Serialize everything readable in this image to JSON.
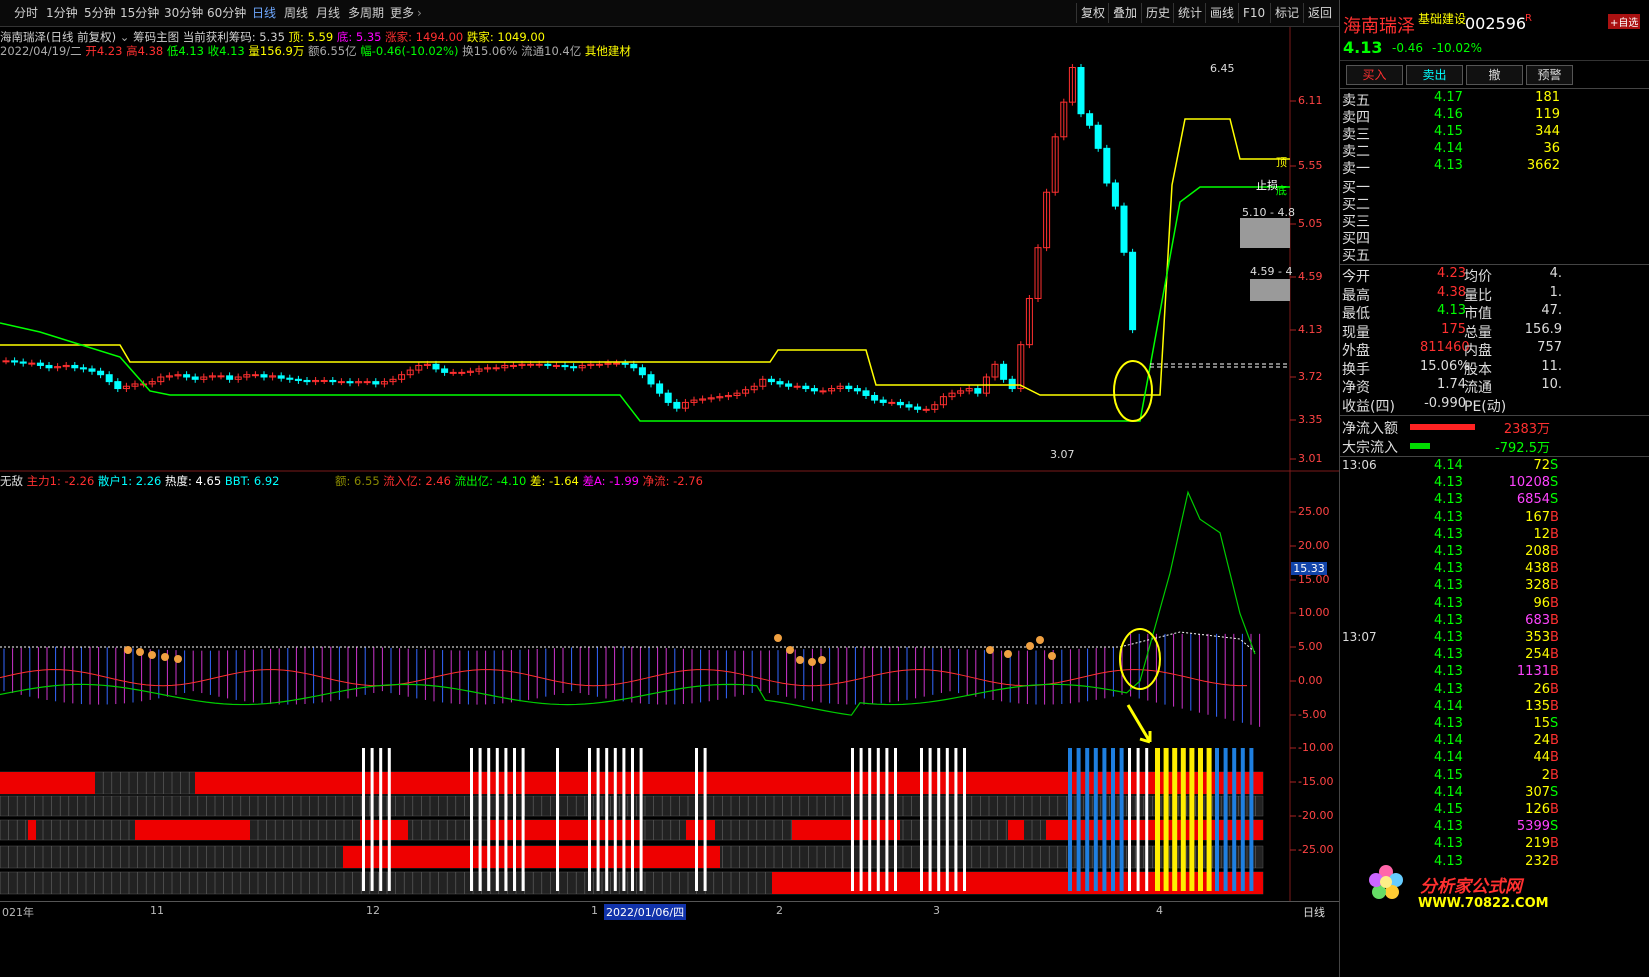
{
  "toolbar": {
    "periods": [
      "分时",
      "1分钟",
      "5分钟",
      "15分钟",
      "30分钟",
      "60分钟",
      "日线",
      "周线",
      "月线",
      "多周期",
      "更多"
    ],
    "active_period": "日线",
    "tools": [
      "复权",
      "叠加",
      "历史",
      "统计",
      "画线",
      "F10",
      "标记",
      "返回"
    ]
  },
  "chart_header": {
    "title": "海南瑞泽(日线 前复权)",
    "indicator_main": "筹码主图",
    "profit_chip": "当前获利筹码: 5.35",
    "top": "顶: 5.59",
    "bottom": "底: 5.35",
    "up_home": "涨家: 1494.00",
    "down_home": "跌家: 1049.00"
  },
  "bar_info": {
    "date": "2022/04/19/二",
    "open": "开4.23",
    "high": "高4.38",
    "low": "低4.13",
    "close": "收4.13",
    "volume": "量156.9万",
    "amount": "额6.55亿",
    "change": "幅-0.46(-10.02%)",
    "turnover": "换15.06%",
    "float": "流通10.4亿",
    "sector": "其他建材"
  },
  "main_axis": [
    "6.11",
    "5.55",
    "5.05",
    "4.59",
    "4.13",
    "3.72",
    "3.35",
    "3.01"
  ],
  "main_labels": {
    "high_mark": "6.45",
    "low_mark": "3.07",
    "top_label": "顶",
    "stop_label": "止损",
    "bottom_label": "底",
    "box1": "5.10 - 4.8",
    "box2": "4.59 - 4"
  },
  "sub_header": {
    "name": "无敌",
    "zl": "主力1: -2.26",
    "sh": "散户1: 2.26",
    "rd": "热度: 4.65",
    "bbt": "BBT: 6.92",
    "e": "额: 6.55",
    "lr": "流入亿: 2.46",
    "lc": "流出亿: -4.10",
    "cha": "差: -1.64",
    "chaA": "差A: -1.99",
    "jl": "净流: -2.76"
  },
  "sub_axis": [
    "25.00",
    "20.00",
    "15.00",
    "10.00",
    "5.00",
    "0.00",
    "-5.00",
    "-10.00",
    "-15.00",
    "-20.00",
    "-25.00"
  ],
  "sub_value_tag": "15.33",
  "date_axis": [
    {
      "label": "021年"
    },
    {
      "label": "11"
    },
    {
      "label": "12"
    },
    {
      "label": "1"
    },
    {
      "label": "2022/01/06/四"
    },
    {
      "label": "2"
    },
    {
      "label": "3"
    },
    {
      "label": "4"
    }
  ],
  "period_tag": "日线",
  "stock": {
    "name": "海南瑞泽",
    "sector_tag": "基础建设",
    "code": "002596",
    "price": "4.13",
    "change": "-0.46",
    "pct": "-10.02%",
    "r_mark": "R",
    "buy_btn": "买入",
    "sell_btn": "卖出",
    "cancel_btn": "撤",
    "pre_btn": "预警",
    "add_btn": "+自选"
  },
  "order_book": {
    "asks": [
      {
        "label": "卖五",
        "price": "4.17",
        "vol": "181"
      },
      {
        "label": "卖四",
        "price": "4.16",
        "vol": "119"
      },
      {
        "label": "卖三",
        "price": "4.15",
        "vol": "344"
      },
      {
        "label": "卖二",
        "price": "4.14",
        "vol": "36"
      },
      {
        "label": "卖一",
        "price": "4.13",
        "vol": "3662"
      }
    ],
    "bids": [
      {
        "label": "买一"
      },
      {
        "label": "买二"
      },
      {
        "label": "买三"
      },
      {
        "label": "买四"
      },
      {
        "label": "买五"
      }
    ]
  },
  "quote": [
    {
      "l1": "今开",
      "v1": "4.23",
      "l2": "均价",
      "v2": "4."
    },
    {
      "l1": "最高",
      "v1": "4.38",
      "l2": "量比",
      "v2": "1."
    },
    {
      "l1": "最低",
      "v1": "4.13",
      "l2": "市值",
      "v2": "47."
    },
    {
      "l1": "现量",
      "v1": "175",
      "l2": "总量",
      "v2": "156.9"
    },
    {
      "l1": "外盘",
      "v1": "811460",
      "l2": "内盘",
      "v2": "757"
    },
    {
      "l1": "换手",
      "v1": "15.06%",
      "l2": "股本",
      "v2": "11."
    },
    {
      "l1": "净资",
      "v1": "1.74",
      "l2": "流通",
      "v2": "10."
    },
    {
      "l1": "收益(四)",
      "v1": "-0.990",
      "l2": "PE(动)",
      "v2": ""
    }
  ],
  "flow": [
    {
      "label": "净流入额",
      "value": "2383万"
    },
    {
      "label": "大宗流入",
      "value": "-792.5万"
    }
  ],
  "ticks": [
    {
      "time": "13:06",
      "price": "4.14",
      "vol": "72",
      "bs": "S"
    },
    {
      "time": "",
      "price": "4.13",
      "vol": "10208",
      "bs": "S"
    },
    {
      "time": "",
      "price": "4.13",
      "vol": "6854",
      "bs": "S"
    },
    {
      "time": "",
      "price": "4.13",
      "vol": "167",
      "bs": "B"
    },
    {
      "time": "",
      "price": "4.13",
      "vol": "12",
      "bs": "B"
    },
    {
      "time": "",
      "price": "4.13",
      "vol": "208",
      "bs": "B"
    },
    {
      "time": "",
      "price": "4.13",
      "vol": "438",
      "bs": "B"
    },
    {
      "time": "",
      "price": "4.13",
      "vol": "328",
      "bs": "B"
    },
    {
      "time": "",
      "price": "4.13",
      "vol": "96",
      "bs": "B"
    },
    {
      "time": "",
      "price": "4.13",
      "vol": "683",
      "bs": "B"
    },
    {
      "time": "13:07",
      "price": "4.13",
      "vol": "353",
      "bs": "B"
    },
    {
      "time": "",
      "price": "4.13",
      "vol": "254",
      "bs": "B"
    },
    {
      "time": "",
      "price": "4.13",
      "vol": "1131",
      "bs": "B"
    },
    {
      "time": "",
      "price": "4.13",
      "vol": "26",
      "bs": "B"
    },
    {
      "time": "",
      "price": "4.14",
      "vol": "135",
      "bs": "B"
    },
    {
      "time": "",
      "price": "4.13",
      "vol": "15",
      "bs": "S"
    },
    {
      "time": "",
      "price": "4.14",
      "vol": "24",
      "bs": "B"
    },
    {
      "time": "",
      "price": "4.14",
      "vol": "44",
      "bs": "B"
    },
    {
      "time": "",
      "price": "4.15",
      "vol": "2",
      "bs": "B"
    },
    {
      "time": "",
      "price": "4.14",
      "vol": "307",
      "bs": "S"
    },
    {
      "time": "",
      "price": "4.15",
      "vol": "126",
      "bs": "B"
    },
    {
      "time": "",
      "price": "4.13",
      "vol": "5399",
      "bs": "S"
    },
    {
      "time": "",
      "price": "4.13",
      "vol": "219",
      "bs": "B"
    },
    {
      "time": "",
      "price": "4.13",
      "vol": "232",
      "bs": "B"
    }
  ],
  "logo": {
    "name": "分析家公式网",
    "url": "WWW.70822.COM"
  },
  "colors": {
    "up": "#ff3030",
    "down": "#00ffff",
    "yellow": "#ffff00",
    "green": "#00ff00",
    "magenta": "#ff00ff"
  }
}
